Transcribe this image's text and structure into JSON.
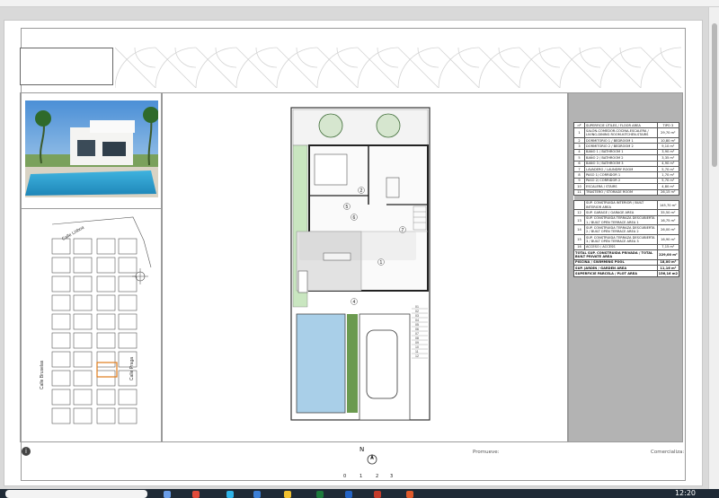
{
  "viewer": {
    "clock": "12:20"
  },
  "plan_labels": {
    "scale_ticks": [
      "0",
      "1",
      "2",
      "3"
    ],
    "north": "N",
    "promueve": "Promueve:",
    "comercializa": "Comercializa:",
    "info_icon": "i",
    "room_numbers": [
      "1",
      "2",
      "4",
      "5",
      "6",
      "7"
    ],
    "stair_steps": [
      "01",
      "02",
      "03",
      "04",
      "05",
      "06",
      "07",
      "08",
      "09",
      "10",
      "11",
      "12"
    ]
  },
  "site_plan": {
    "street_top": "Calle Lisboa",
    "street_left": "Calle Bruselas",
    "street_right": "Calle Praga"
  },
  "area_table": {
    "header": {
      "num": "nº",
      "desc": "SUPERFICIE ÚTILES / FLOOR AREA",
      "type": "TIPO 3"
    },
    "rooms": [
      {
        "num": "1",
        "desc": "SALÓN-COMEDOR-COCINA-ESCALERA / LIVING-DINING ROOM-KITCHEN-STAIRS",
        "value": "29,70 m²"
      },
      {
        "num": "2",
        "desc": "DORMITORIO 1 / BEDROOM 1",
        "value": "10,80 m²"
      },
      {
        "num": "3",
        "desc": "DORMITORIO 2 / BEDROOM 2",
        "value": "9,10 m²"
      },
      {
        "num": "4",
        "desc": "BAÑO 1 / BATHROOM 1",
        "value": "3,90 m²"
      },
      {
        "num": "5",
        "desc": "BAÑO 2 / BATHROOM 2",
        "value": "3,35 m²"
      },
      {
        "num": "6",
        "desc": "BAÑO 3 / BATHROOM 3",
        "value": "4,90 m²"
      },
      {
        "num": "7",
        "desc": "LAVADERO / LAUNDRY ROOM",
        "value": "5,70 m²"
      },
      {
        "num": "8",
        "desc": "PASO 1/ CORRIDOR 1",
        "value": "1,70 m²"
      },
      {
        "num": "9",
        "desc": "PASO 2/ CORRIDOR 2",
        "value": "5,70 m²"
      },
      {
        "num": "10",
        "desc": "ESCALERA / STAIRS",
        "value": "4,80 m²"
      },
      {
        "num": "11",
        "desc": "TRASTERO / STORAGE ROOM",
        "value": "26,15 m²"
      }
    ],
    "interior_total": {
      "desc": "SUP. CONSTRUIDA INTERIOR / BUILT INTERIOR AREA",
      "value": "145,70 m²"
    },
    "exterior": [
      {
        "num": "12",
        "desc": "SUP. GARAGE / GARAGE AREA",
        "value": "35,50 m²"
      },
      {
        "num": "13",
        "desc": "SUP. CONSTRUIDA TERRAZA DESCUBIERTA 1 / BUILT OPEN TERRACE AREA 1",
        "value": "16,75 m²"
      },
      {
        "num": "14",
        "desc": "SUP. CONSTRUIDA TERRAZA DESCUBIERTA 2 / BUILT OPEN TERRACE AREA 2",
        "value": "26,00 m²"
      },
      {
        "num": "15",
        "desc": "SUP. CONSTRUIDA TERRAZA DESCUBIERTA 3 / BUILT OPEN TERRACE AREA 3",
        "value": "16,90 m²"
      },
      {
        "num": "16",
        "desc": "ACCESO / ACCESS",
        "value": "7,15 m²"
      }
    ],
    "totals": [
      {
        "desc": "TOTAL SUP. CONSTRUIDA PRIVADA / TOTAL BUILT PRIVATE AREA",
        "value": "229,00 m²"
      },
      {
        "desc": "PISCINA / SWIMMING POOL",
        "value": "18,00 m²"
      },
      {
        "desc": "SUP. JARDÍN / GARDEN AREA",
        "value": "11,16 m²"
      },
      {
        "desc": "SUPERFICIE PARCELA / PLOT AREA",
        "value": "156,16 m2"
      }
    ]
  },
  "colors": {
    "pool": "#a9cfe8",
    "garden": "#c9e6c0",
    "table_bg": "#b3b3b3",
    "taskbar": "#1f2a36"
  }
}
